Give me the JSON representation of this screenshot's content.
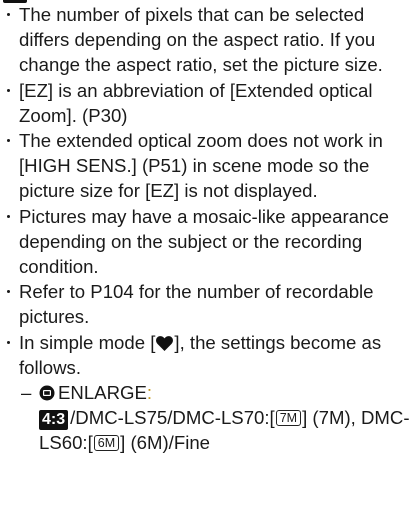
{
  "notes": [
    "The number of pixels that can be selected differs depending on the aspect ratio. If you change the aspect ratio, set the picture size.",
    "[EZ] is an abbreviation of [Extended optical Zoom]. (P30)",
    "The extended optical zoom does not work in [HIGH SENS.] (P51) in scene mode so the picture size for [EZ] is not displayed.",
    "Pictures may have a mosaic-like appearance depending on the subject or the recording condition.",
    "Refer to P104 for the number of recordable pictures."
  ],
  "simple_mode": {
    "before_icon": "In simple mode [",
    "after_icon": "], the settings become as follows.",
    "icon": "heart-icon",
    "enlarge": {
      "dash": "–",
      "icon": "enlarge-mode-icon",
      "label": "ENLARGE",
      "colon": ":",
      "aspect_badge": "4:3",
      "text1": "/DMC-LS75/DMC-LS70:[",
      "badge_7m": "7M",
      "text2": "] (7M), DMC-LS60:[",
      "badge_6m": "6M",
      "text3": "] (6M)/Fine"
    }
  },
  "colors": {
    "text": "#1a1a1a",
    "accent": "#c59a1c",
    "badge_bg": "#111111"
  }
}
